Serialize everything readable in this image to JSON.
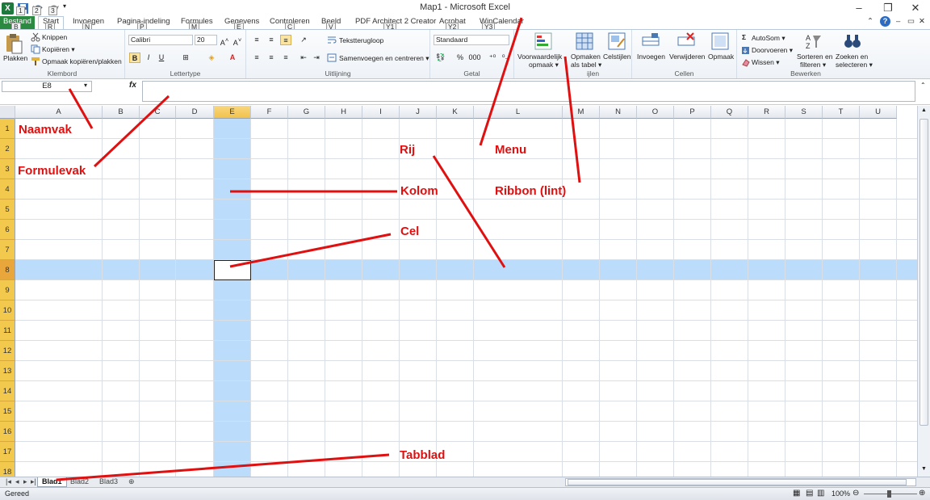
{
  "window": {
    "title": "Map1 - Microsoft Excel",
    "minimize": "–",
    "restore": "❐",
    "close": "✕",
    "qat_keytips": [
      "1",
      "2",
      "3"
    ]
  },
  "ribbon_tabs": [
    {
      "label": "Bestand",
      "keytip": "B"
    },
    {
      "label": "Start",
      "keytip": "R"
    },
    {
      "label": "Invoegen",
      "keytip": "N"
    },
    {
      "label": "Pagina-indeling",
      "keytip": "P"
    },
    {
      "label": "Formules",
      "keytip": "M"
    },
    {
      "label": "Gegevens",
      "keytip": "E"
    },
    {
      "label": "Controleren",
      "keytip": "C"
    },
    {
      "label": "Beeld",
      "keytip": "V"
    },
    {
      "label": "PDF Architect 2 Creator",
      "keytip": "Y1"
    },
    {
      "label": "Acrobat",
      "keytip": "Y2"
    },
    {
      "label": "WinCalendar",
      "keytip": "Y3"
    }
  ],
  "ribbon": {
    "klembord": {
      "label": "Klembord",
      "plakken": "Plakken",
      "knippen": "Knippen",
      "kopieren": "Kopiëren ▾",
      "opmaak": "Opmaak kopiëren/plakken"
    },
    "lettertype": {
      "label": "Lettertype",
      "font": "Calibri",
      "size": "20",
      "bold": "B",
      "italic": "I",
      "underline": "U"
    },
    "uitlijning": {
      "label": "Uitlijning",
      "terugloop": "Tekstterugloop",
      "samenvoegen": "Samenvoegen en centreren ▾"
    },
    "getal": {
      "label": "Getal",
      "format": "Standaard",
      "percent": "%",
      "thousands": "000"
    },
    "stijlen": {
      "label": "ijlen",
      "voorwaardelijk": "Voorwaardelijk",
      "opmaak": "opmaak ▾",
      "opmaken": "Opmaken",
      "als_tabel": "als tabel ▾",
      "celstijlen": "Celstijlen"
    },
    "cellen": {
      "label": "Cellen",
      "invoegen": "Invoegen",
      "verwijderen": "Verwijderen",
      "opmaak": "Opmaak"
    },
    "bewerken": {
      "label": "Bewerken",
      "autosom": "AutoSom ▾",
      "doorvoeren": "Doorvoeren ▾",
      "wissen": "Wissen ▾",
      "sorteren": "Sorteren en",
      "filteren": "filteren ▾",
      "zoeken": "Zoeken en",
      "selecteren": "selecteren ▾"
    }
  },
  "formula_bar": {
    "name_box": "E8",
    "fx": "fx",
    "formula": ""
  },
  "grid": {
    "columns": [
      "A",
      "B",
      "C",
      "D",
      "E",
      "F",
      "G",
      "H",
      "I",
      "J",
      "K",
      "L",
      "M",
      "N",
      "O",
      "P",
      "Q",
      "R",
      "S",
      "T",
      "U"
    ],
    "rows": [
      "1",
      "2",
      "3",
      "4",
      "5",
      "6",
      "7",
      "8",
      "9",
      "10",
      "11",
      "12",
      "13",
      "14",
      "15",
      "16",
      "17",
      "18"
    ],
    "selected_column": "E",
    "selected_row": "8"
  },
  "sheet_tabs": [
    "Blad1",
    "Blad2",
    "Blad3"
  ],
  "status": {
    "text": "Gereed",
    "zoom": "100%"
  },
  "annotations": {
    "naamvak": "Naamvak",
    "formulevak": "Formulevak",
    "rij": "Rij",
    "menu": "Menu",
    "kolom": "Kolom",
    "ribbon": "Ribbon (lint)",
    "cel": "Cel",
    "tabblad": "Tabblad"
  },
  "colors": {
    "annotation": "#e01010",
    "highlight": "#bcdcfb",
    "file_tab": "#2a8a3f"
  }
}
